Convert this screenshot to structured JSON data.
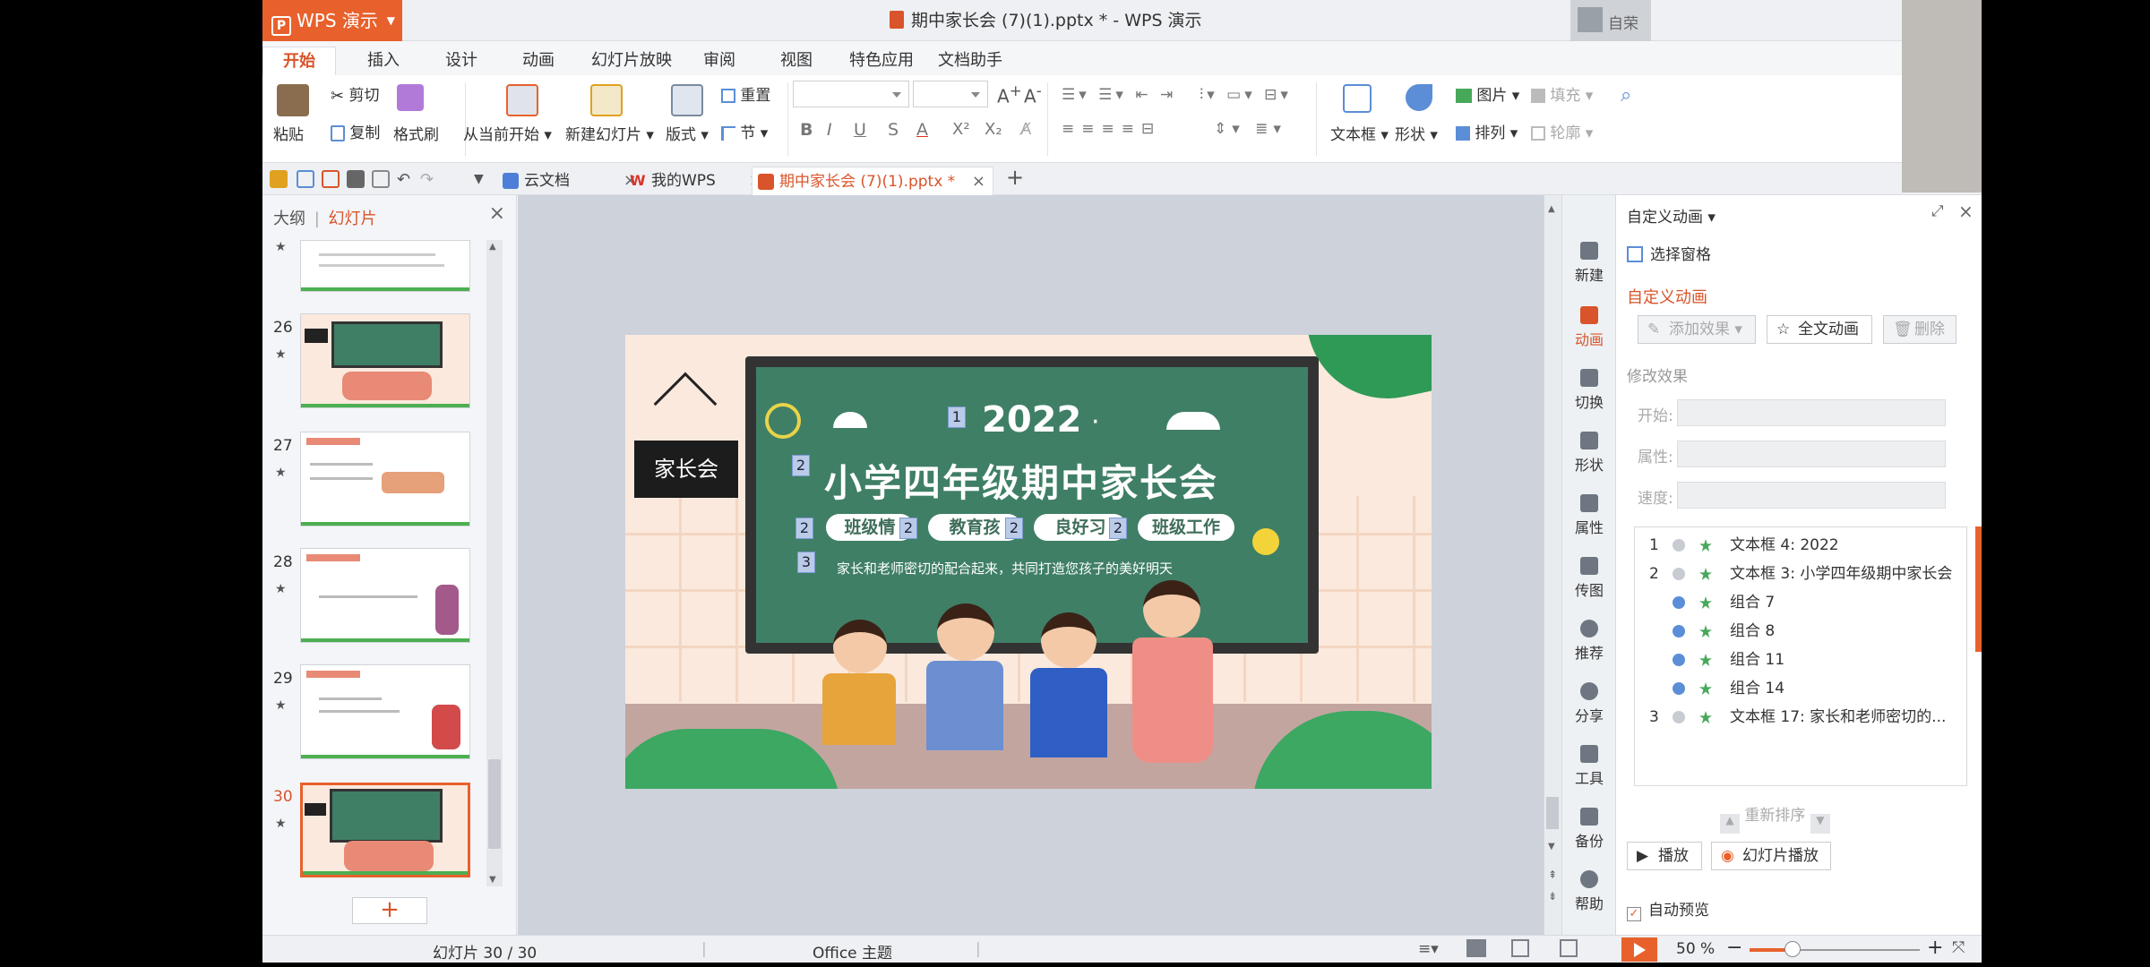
{
  "app": {
    "menu_button": "WPS 演示",
    "window_title": "期中家长会 (7)(1).pptx * - WPS 演示",
    "user_label": "自荣"
  },
  "menu_tabs": [
    "开始",
    "插入",
    "设计",
    "动画",
    "幻灯片放映",
    "审阅",
    "视图",
    "特色应用",
    "文档助手"
  ],
  "ribbon": {
    "paste": "粘贴",
    "cut": "剪切",
    "copy": "复制",
    "format_painter": "格式刷",
    "from_current": "从当前开始",
    "new_slide": "新建幻灯片",
    "layout": "版式",
    "reset": "重置",
    "section": "节",
    "bold": "B",
    "italic": "I",
    "underline": "U",
    "shadow": "S",
    "font_color": "A",
    "superscript": "X²",
    "subscript": "X₂",
    "text_box": "文本框",
    "shape": "形状",
    "picture": "图片",
    "fill": "填充",
    "arrange": "排列",
    "outline": "轮廓"
  },
  "doc_tabs": [
    {
      "label": "云文档"
    },
    {
      "label": "我的WPS"
    },
    {
      "label": "期中家长会 (7)(1).pptx *"
    }
  ],
  "left_panel": {
    "tab_outline": "大纲",
    "tab_separator": "|",
    "tab_slides": "幻灯片",
    "thumb_numbers": [
      "26",
      "27",
      "28",
      "29",
      "30"
    ],
    "add_button": "+"
  },
  "slide": {
    "year": "2022",
    "dot": "·",
    "title": "小学四年级期中家长会",
    "sign": "家长会",
    "pills": [
      "班级情",
      "教育孩",
      "良好习",
      "班级工作"
    ],
    "subtitle": "家长和老师密切的配合起来，共同打造您孩子的美好明天",
    "anim_tags": [
      "1",
      "2",
      "2",
      "2",
      "2",
      "2",
      "3"
    ]
  },
  "sidebar": [
    "新建",
    "动画",
    "切换",
    "形状",
    "属性",
    "传图",
    "推荐",
    "分享",
    "工具",
    "备份",
    "帮助"
  ],
  "task_pane": {
    "header": "自定义动画",
    "select_pane": "选择窗格",
    "section_title": "自定义动画",
    "add_effect": "添加效果",
    "full_anim": "全文动画",
    "delete": "删除",
    "modify_title": "修改效果",
    "start_label": "开始:",
    "property_label": "属性:",
    "speed_label": "速度:",
    "items": [
      {
        "num": "1",
        "text": "文本框 4: 2022"
      },
      {
        "num": "2",
        "text": "文本框 3: 小学四年级期中家长会"
      },
      {
        "num": "",
        "text": "组合 7"
      },
      {
        "num": "",
        "text": "组合 8"
      },
      {
        "num": "",
        "text": "组合 11"
      },
      {
        "num": "",
        "text": "组合 14"
      },
      {
        "num": "3",
        "text": "文本框 17: 家长和老师密切的..."
      }
    ],
    "reorder": "重新排序",
    "play": "播放",
    "slideshow": "幻灯片播放",
    "auto_preview": "自动预览"
  },
  "status": {
    "slide_counter": "幻灯片 30 / 30",
    "theme": "Office 主题",
    "zoom": "50 %",
    "zoom_level": 0.25
  }
}
